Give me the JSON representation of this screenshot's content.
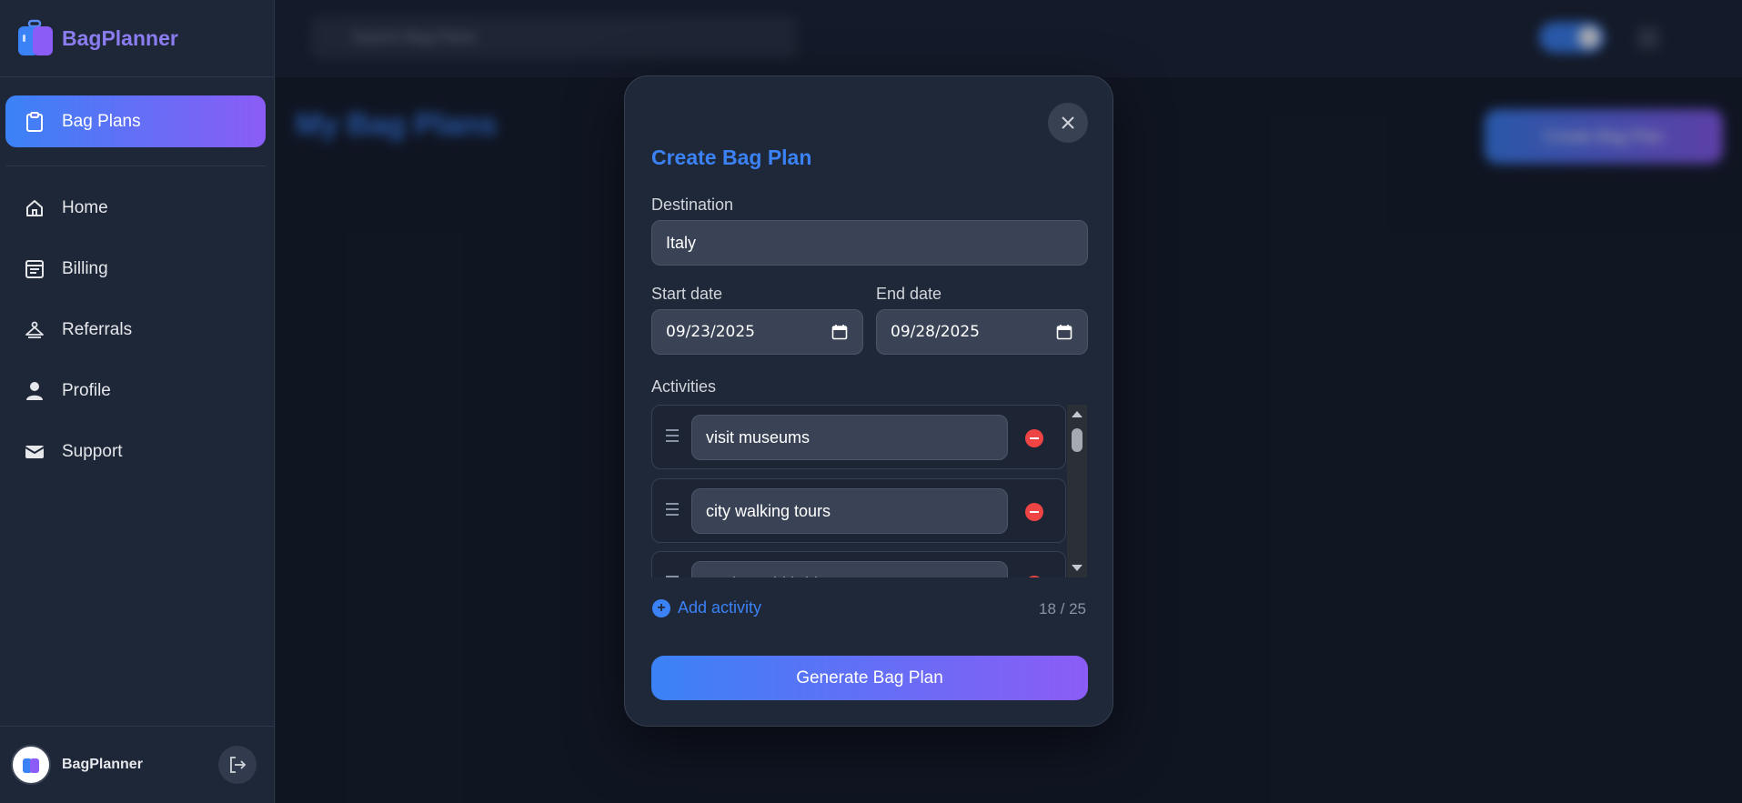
{
  "brand": {
    "name": "BagPlanner"
  },
  "sidebar": {
    "active_item": "Bag Plans",
    "items": [
      {
        "label": "Home",
        "icon": "home-icon"
      },
      {
        "label": "Billing",
        "icon": "billing-icon"
      },
      {
        "label": "Referrals",
        "icon": "hanger-icon"
      },
      {
        "label": "Profile",
        "icon": "person-icon"
      },
      {
        "label": "Support",
        "icon": "mail-icon"
      }
    ],
    "footer_name": "BagPlanner"
  },
  "background": {
    "search_placeholder": "Search Bag Plans",
    "page_title": "My Bag Plans",
    "create_button": "Create Bag Plan"
  },
  "modal": {
    "title": "Create Bag Plan",
    "destination_label": "Destination",
    "destination_value": "Italy",
    "start_label": "Start date",
    "start_value": "09/23/2025",
    "end_label": "End date",
    "end_value": "09/28/2025",
    "activities_label": "Activities",
    "activities": [
      "visit museums",
      "city walking tours",
      "explore old bridges"
    ],
    "add_activity_label": "Add activity",
    "counter": "18 / 25",
    "generate_label": "Generate Bag Plan"
  },
  "colors": {
    "accent_blue": "#3b82f6",
    "accent_purple": "#8b5cf6",
    "danger": "#ef4444",
    "background": "#141b29",
    "panel": "#1f2838"
  }
}
